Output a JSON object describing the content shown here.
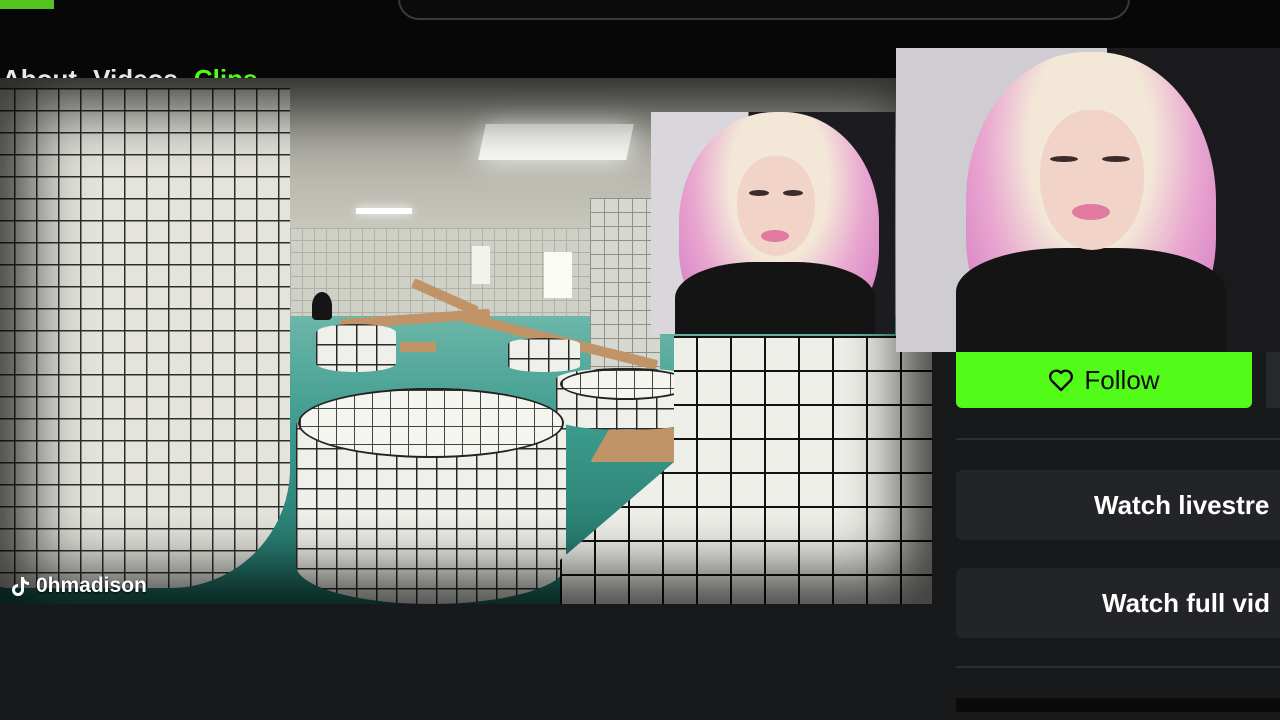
{
  "channel_nav": {
    "items": [
      "About",
      "Videos",
      "Clips"
    ]
  },
  "stream": {
    "watermark_icon": "tiktok-icon",
    "watermark_text": "0hmadison"
  },
  "sidebar": {
    "follow_icon": "heart-icon",
    "follow_label": "Follow",
    "watch_livestream_label": "Watch livestre",
    "watch_full_video_label": "Watch full vid"
  },
  "colors": {
    "accent": "#53fc18",
    "background": "#18191b",
    "topbar": "#070707",
    "button_bg": "#232427"
  }
}
